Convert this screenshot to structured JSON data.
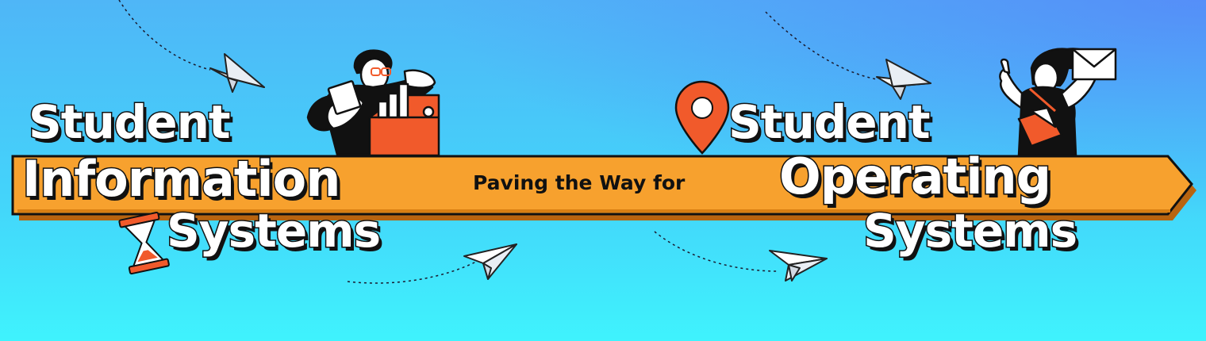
{
  "left_title": {
    "line1": "Student",
    "line2": "Information",
    "line3": "Systems"
  },
  "tagline": "Paving the Way for",
  "right_title": {
    "line1": "Student",
    "line2": "Operating",
    "line3": "Systems"
  },
  "icons": [
    "paper-plane-icon",
    "location-pin-icon",
    "hourglass-icon",
    "envelope-icon",
    "bar-chart-icon"
  ],
  "colors": {
    "background_top": "#4fb6f7",
    "background_bottom": "#3ff3fd",
    "arrow_band": "#f7a12e",
    "accent_orange": "#f15a2b",
    "text_outline": "#111111"
  }
}
